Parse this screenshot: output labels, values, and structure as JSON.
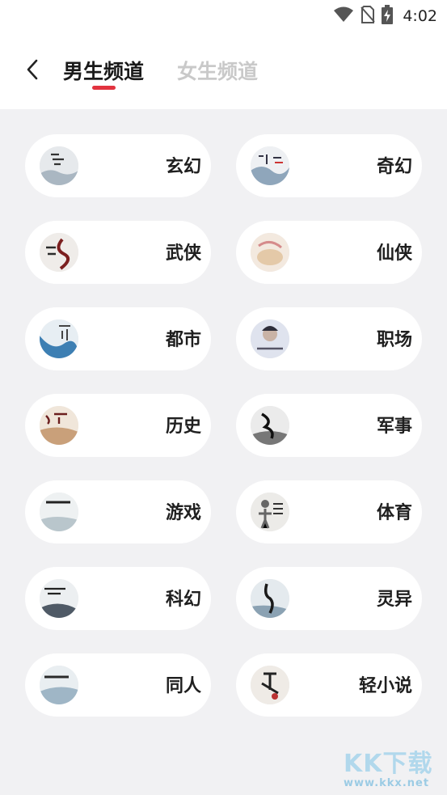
{
  "statusbar": {
    "time": "4:02",
    "icons": [
      "wifi-icon",
      "no-sim-icon",
      "battery-charging-icon"
    ]
  },
  "header": {
    "back_icon": "chevron-left-icon",
    "tabs": [
      {
        "label": "男生频道",
        "active": true
      },
      {
        "label": "女生频道",
        "active": false
      }
    ],
    "accent": "#e2333f"
  },
  "categories": [
    {
      "label": "玄幻"
    },
    {
      "label": "奇幻"
    },
    {
      "label": "武侠"
    },
    {
      "label": "仙侠"
    },
    {
      "label": "都市"
    },
    {
      "label": "职场"
    },
    {
      "label": "历史"
    },
    {
      "label": "军事"
    },
    {
      "label": "游戏"
    },
    {
      "label": "体育"
    },
    {
      "label": "科幻"
    },
    {
      "label": "灵异"
    },
    {
      "label": "同人"
    },
    {
      "label": "轻小说"
    }
  ],
  "watermark": {
    "brand": "KK下载",
    "url": "www.kkx.net"
  }
}
